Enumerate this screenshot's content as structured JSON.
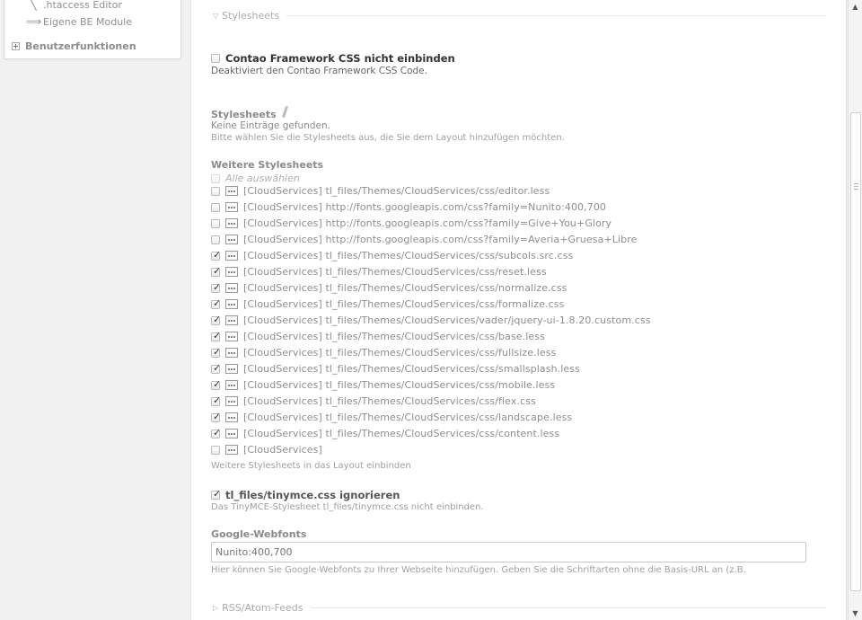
{
  "nav": {
    "items": [
      {
        "label": ".htaccess Editor",
        "icon": "pen-icon"
      },
      {
        "label": "Eigene BE Module",
        "icon": "arrow-right-icon"
      }
    ],
    "group": "Benutzerfunktionen"
  },
  "sections": {
    "stylesheets_legend": "Stylesheets",
    "rss_legend": "RSS/Atom-Feeds"
  },
  "framework": {
    "label": "Contao Framework CSS nicht einbinden",
    "desc": "Deaktiviert den Contao Framework CSS Code.",
    "checked": false
  },
  "stylesheets": {
    "label": "Stylesheets",
    "empty": "Keine Einträge gefunden.",
    "tip": "Bitte wählen Sie die Stylesheets aus, die Sie dem Layout hinzufügen möchten."
  },
  "external": {
    "label": "Weitere Stylesheets",
    "select_all": "Alle auswählen",
    "items": [
      {
        "label": "[CloudServices] tl_files/Themes/CloudServices/css/editor.less",
        "checked": false
      },
      {
        "label": "[CloudServices] http://fonts.googleapis.com/css?family=Nunito:400,700",
        "checked": false
      },
      {
        "label": "[CloudServices] http://fonts.googleapis.com/css?family=Give+You+Glory",
        "checked": false
      },
      {
        "label": "[CloudServices] http://fonts.googleapis.com/css?family=Averia+Gruesa+Libre",
        "checked": false
      },
      {
        "label": "[CloudServices] tl_files/Themes/CloudServices/css/subcols.src.css",
        "checked": true
      },
      {
        "label": "[CloudServices] tl_files/Themes/CloudServices/css/reset.less",
        "checked": true
      },
      {
        "label": "[CloudServices] tl_files/Themes/CloudServices/css/normalize.css",
        "checked": true
      },
      {
        "label": "[CloudServices] tl_files/Themes/CloudServices/css/formalize.css",
        "checked": true
      },
      {
        "label": "[CloudServices] tl_files/Themes/CloudServices/vader/jquery-ui-1.8.20.custom.css",
        "checked": true
      },
      {
        "label": "[CloudServices] tl_files/Themes/CloudServices/css/base.less",
        "checked": true
      },
      {
        "label": "[CloudServices] tl_files/Themes/CloudServices/css/fullsize.less",
        "checked": true
      },
      {
        "label": "[CloudServices] tl_files/Themes/CloudServices/css/smallsplash.less",
        "checked": true
      },
      {
        "label": "[CloudServices] tl_files/Themes/CloudServices/css/mobile.less",
        "checked": true
      },
      {
        "label": "[CloudServices] tl_files/Themes/CloudServices/css/flex.css",
        "checked": true
      },
      {
        "label": "[CloudServices] tl_files/Themes/CloudServices/css/landscape.less",
        "checked": true
      },
      {
        "label": "[CloudServices] tl_files/Themes/CloudServices/css/content.less",
        "checked": true
      },
      {
        "label": "[CloudServices]",
        "checked": false
      }
    ],
    "tip": "Weitere Stylesheets in das Layout einbinden"
  },
  "tinymce": {
    "label": "tl_files/tinymce.css ignorieren",
    "desc": "Das TinyMCE-Stylesheet tl_files/tinymce.css nicht einbinden.",
    "checked": true
  },
  "webfonts": {
    "label": "Google-Webfonts",
    "value": "Nunito:400,700",
    "tip": "Hier können Sie Google-Webfonts zu Ihrer Webseite hinzufügen. Geben Sie die Schriftarten ohne die Basis-URL an (z.B."
  }
}
